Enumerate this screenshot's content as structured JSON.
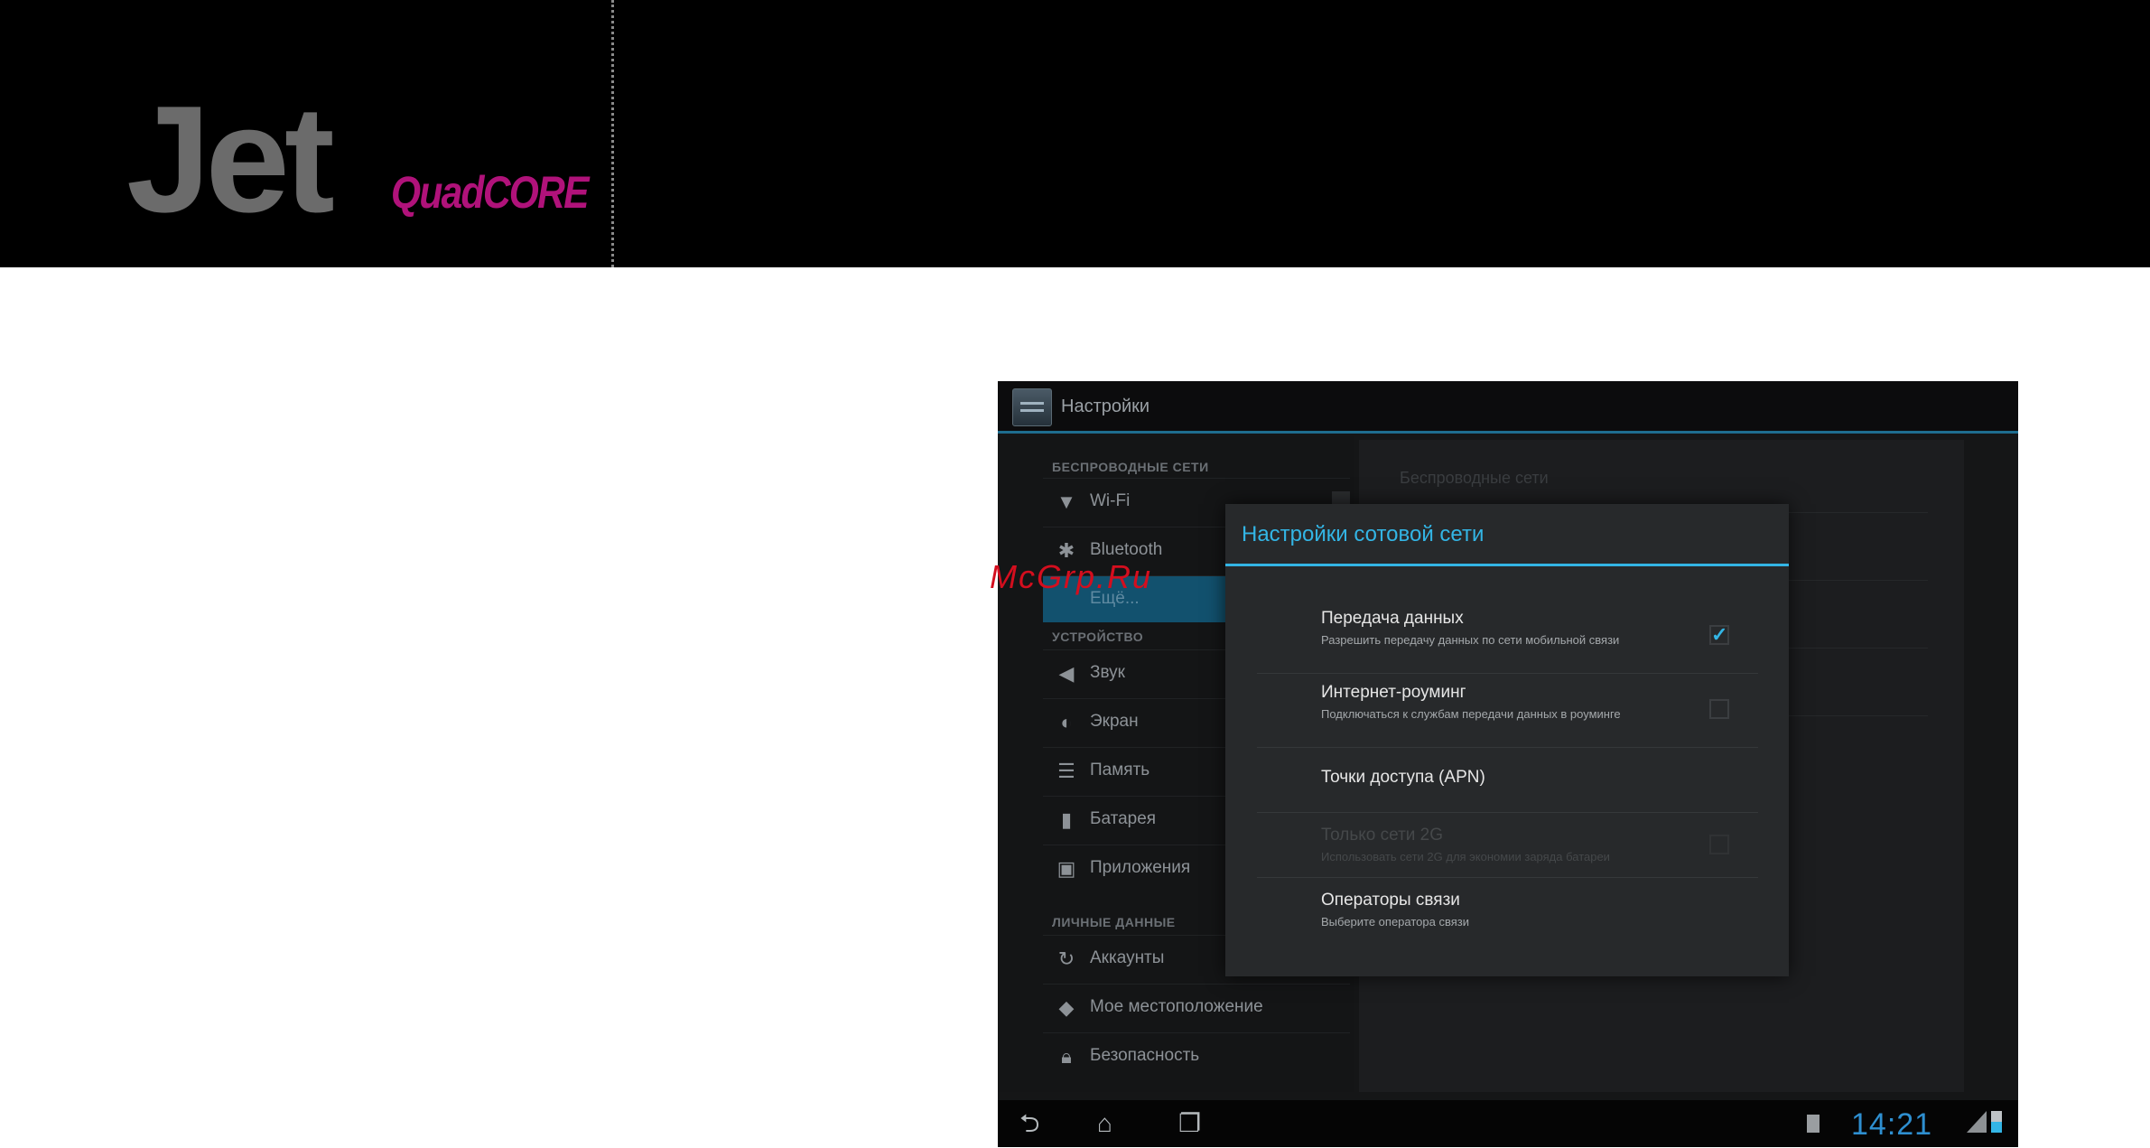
{
  "brand": {
    "name": "Jet",
    "subtitle": "QuadCORE",
    "subtitle_color": "#b0127a"
  },
  "watermark": "McGrp.Ru",
  "settings": {
    "title": "Настройки",
    "left_pane": {
      "category_wireless": "БЕСПРОВОДНЫЕ СЕТИ",
      "category_device": "УСТРОЙСТВО",
      "category_personal": "ЛИЧНЫЕ ДАННЫЕ",
      "items": {
        "wifi": "Wi-Fi",
        "bluetooth": "Bluetooth",
        "more": "Ещё...",
        "sound": "Звук",
        "screen": "Экран",
        "memory": "Память",
        "battery": "Батарея",
        "apps": "Приложения",
        "accounts": "Аккаунты",
        "location": "Мое местоположение",
        "security": "Безопасность"
      },
      "icons": {
        "wifi": "wifi-icon",
        "bluetooth": "bluetooth-icon",
        "sound": "speaker-icon",
        "screen": "brightness-icon",
        "memory": "storage-icon",
        "battery": "battery-icon",
        "apps": "apps-icon",
        "accounts": "sync-icon",
        "location": "location-icon",
        "security": "lock-icon"
      }
    },
    "right_pane": {
      "title": "Беспроводные сети"
    }
  },
  "dialog": {
    "title": "Настройки сотовой сети",
    "accent_color": "#33b5e5",
    "options": [
      {
        "title": "Передача данных",
        "summary": "Разрешить передачу данных по сети мобильной связи",
        "checked": true,
        "enabled": true
      },
      {
        "title": "Интернет-роуминг",
        "summary": "Подключаться к службам передачи данных в роуминге",
        "checked": false,
        "enabled": true
      },
      {
        "title": "Точки доступа (APN)",
        "summary": "",
        "enabled": true
      },
      {
        "title": "Только сети 2G",
        "summary": "Использовать сети 2G для экономии заряда батареи",
        "checked": false,
        "enabled": false
      },
      {
        "title": "Операторы связи",
        "summary": "Выберите оператора связи",
        "enabled": true
      }
    ]
  },
  "status_bar": {
    "time": "14:21",
    "nav_back": "back-icon",
    "nav_home": "home-icon",
    "nav_recent": "recent-apps-icon"
  }
}
